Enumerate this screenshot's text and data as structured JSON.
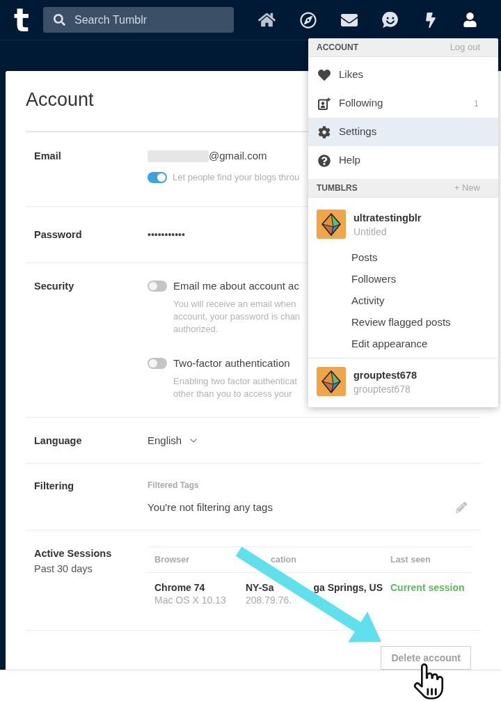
{
  "top_bar": {
    "logo": "t",
    "search": {
      "placeholder": "Search Tumblr"
    },
    "nav": [
      {
        "kind": "home"
      },
      {
        "kind": "explore"
      },
      {
        "kind": "inbox"
      },
      {
        "kind": "messaging"
      },
      {
        "kind": "activity"
      },
      {
        "kind": "account"
      }
    ]
  },
  "settings_page": {
    "title": "Account",
    "sections": [
      {
        "kind": "email",
        "label": "Email",
        "value": "@gmail.com",
        "toggle": {
          "on": true,
          "label": "Let people find your blogs throu"
        }
      },
      {
        "kind": "password",
        "label": "Password",
        "value": "•••••••••••"
      },
      {
        "kind": "security",
        "label": "Security",
        "options": [
          {
            "on": false,
            "label": "Email me about account ac",
            "description": [
              "You will receive an email when",
              "account, your password is chan",
              "authorized."
            ]
          },
          {
            "on": false,
            "label": "Two-factor authentication",
            "description": [
              "Enabling two factor authenticat",
              "other than you to access your"
            ]
          }
        ]
      },
      {
        "kind": "language",
        "label": "Language",
        "value": "English"
      },
      {
        "kind": "filtering",
        "label": "Filtering",
        "caption": "Filtered Tags",
        "value": "You're not filtering any tags"
      },
      {
        "kind": "sessions",
        "label": "Active Sessions",
        "sublabel": "Past 30 days",
        "table": {
          "columns": [
            "Browser",
            "cation",
            "Last seen"
          ],
          "rows": [
            {
              "browser": "Chrome 74",
              "os": "Mac OS X 10.13",
              "location": [
                "NY-Sa",
                "ga Springs, US"
              ],
              "ip": "208.79.76.",
              "last_seen": "Current session"
            }
          ]
        }
      }
    ],
    "delete_button": "Delete account"
  },
  "account_menu": {
    "header": {
      "title": "ACCOUNT",
      "action": "Log out"
    },
    "items": [
      {
        "kind": "heart",
        "label": "Likes",
        "selected": false
      },
      {
        "kind": "following",
        "label": "Following",
        "count": "1",
        "selected": false
      },
      {
        "kind": "gear",
        "label": "Settings",
        "selected": true
      },
      {
        "kind": "help",
        "label": "Help",
        "selected": false
      }
    ],
    "tumblrs_header": {
      "title": "TUMBLRS",
      "action": "+ New"
    },
    "blogs": [
      {
        "name": "ultratestingblr",
        "subtitle": "Untitled",
        "links": [
          "Posts",
          "Followers",
          "Activity",
          "Review flagged posts",
          "Edit appearance"
        ]
      },
      {
        "name": "grouptest678",
        "subtitle": "grouptest678"
      }
    ]
  }
}
